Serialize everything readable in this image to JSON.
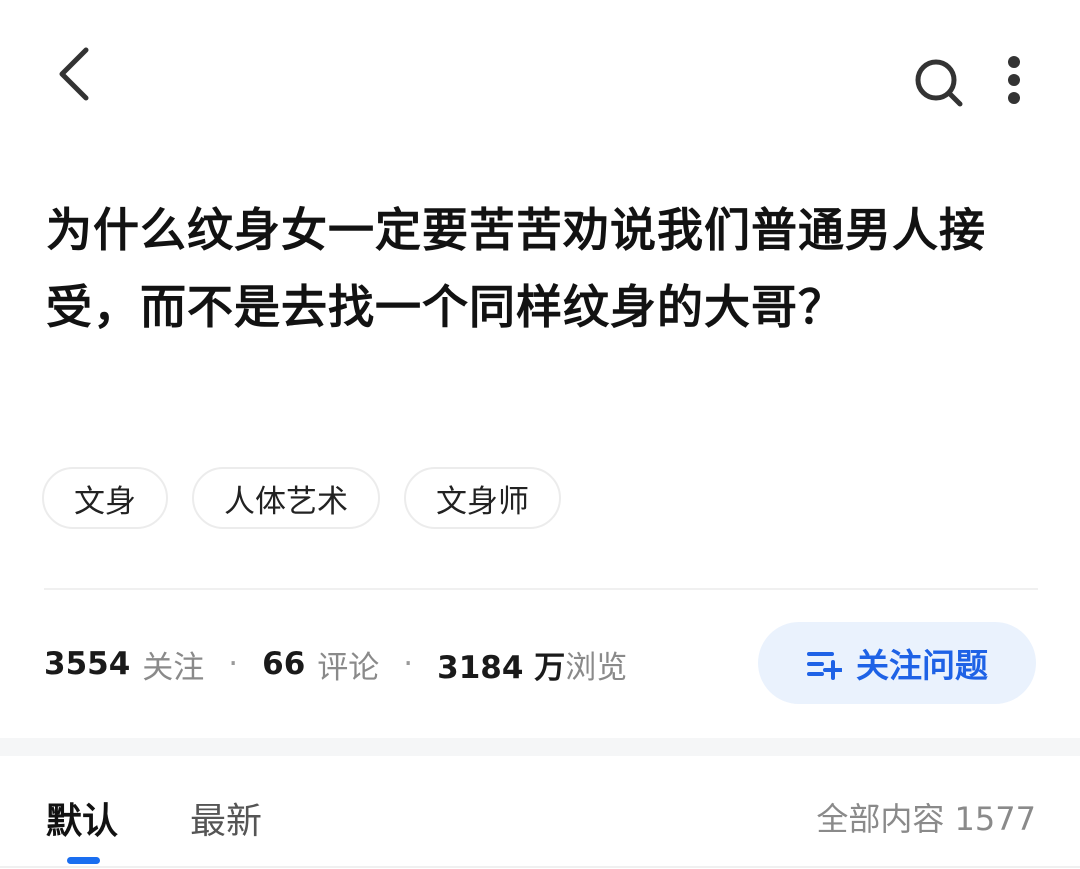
{
  "header": {
    "back_icon": "chevron-left-icon",
    "search_icon": "search-icon",
    "more_icon": "more-vertical-icon"
  },
  "question": {
    "title": "为什么纹身女一定要苦苦劝说我们普通男人接受，而不是去找一个同样纹身的大哥？"
  },
  "tags": [
    "文身",
    "人体艺术",
    "文身师"
  ],
  "stats": {
    "followers_count": "3554",
    "followers_label": "关注",
    "comments_count": "66",
    "comments_label": "评论",
    "views_count": "3184 万",
    "views_label": "浏览",
    "separator": "·"
  },
  "follow_button": {
    "label": "关注问题",
    "icon": "add-list-icon"
  },
  "tabs": {
    "default_label": "默认",
    "latest_label": "最新",
    "total_label": "全部内容 1577"
  },
  "colors": {
    "accent": "#1e62e6",
    "button_bg": "#eaf2fd",
    "indicator": "#1a6ef0"
  }
}
